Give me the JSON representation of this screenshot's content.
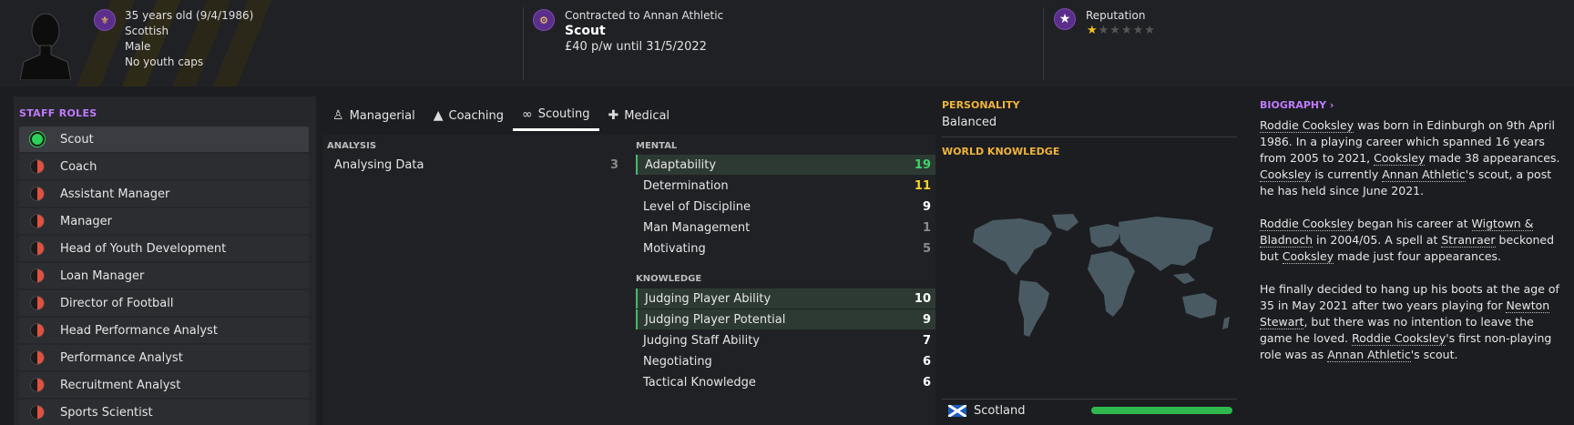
{
  "header": {
    "age_line": "35 years old (9/4/1986)",
    "nationality": "Scottish",
    "gender": "Male",
    "caps": "No youth caps",
    "contract_line": "Contracted to Annan Athletic",
    "job": "Scout",
    "wage_line": "£40 p/w until 31/5/2022",
    "reputation_label": "Reputation",
    "reputation_stars": 0.5,
    "reputation_max": 5
  },
  "staff_roles": {
    "title": "STAFF ROLES",
    "items": [
      {
        "label": "Scout",
        "status": "green"
      },
      {
        "label": "Coach",
        "status": "half"
      },
      {
        "label": "Assistant Manager",
        "status": "half"
      },
      {
        "label": "Manager",
        "status": "half"
      },
      {
        "label": "Head of Youth Development",
        "status": "half"
      },
      {
        "label": "Loan Manager",
        "status": "half"
      },
      {
        "label": "Director of Football",
        "status": "half"
      },
      {
        "label": "Head Performance Analyst",
        "status": "half"
      },
      {
        "label": "Performance Analyst",
        "status": "half"
      },
      {
        "label": "Recruitment Analyst",
        "status": "half"
      },
      {
        "label": "Sports Scientist",
        "status": "half"
      }
    ]
  },
  "tabs": [
    "Managerial",
    "Coaching",
    "Scouting",
    "Medical"
  ],
  "analysis": {
    "title": "ANALYSIS",
    "items": [
      {
        "label": "Analysing Data",
        "value": "3"
      }
    ]
  },
  "mental": {
    "title": "MENTAL",
    "items": [
      {
        "label": "Adaptability",
        "value": "19"
      },
      {
        "label": "Determination",
        "value": "11"
      },
      {
        "label": "Level of Discipline",
        "value": "9"
      },
      {
        "label": "Man Management",
        "value": "1"
      },
      {
        "label": "Motivating",
        "value": "5"
      }
    ]
  },
  "knowledge": {
    "title": "KNOWLEDGE",
    "items": [
      {
        "label": "Judging Player Ability",
        "value": "10"
      },
      {
        "label": "Judging Player Potential",
        "value": "9"
      },
      {
        "label": "Judging Staff Ability",
        "value": "7"
      },
      {
        "label": "Negotiating",
        "value": "6"
      },
      {
        "label": "Tactical Knowledge",
        "value": "6"
      }
    ]
  },
  "personality": {
    "title": "PERSONALITY",
    "value": "Balanced",
    "world_title": "WORLD KNOWLEDGE",
    "country": "Scotland",
    "country_knowledge": 1.0
  },
  "biography": {
    "title": "BIOGRAPHY ›",
    "p1": "was born in Edinburgh on 9th April 1986. In a playing career which spanned 16 years from 2005 to 2021,",
    "p1b": "made 38 appearances.",
    "p1c": "is currently",
    "p1d": "'s scout, a post he has held since June 2021.",
    "name": "Roddie Cooksley",
    "surname": "Cooksley",
    "club": "Annan Athletic",
    "p2a": "began his career at",
    "club2": "Wigtown & Bladnoch",
    "p2b": "in 2004/05. A spell at",
    "club3": "Stranraer",
    "p2c": "beckoned but",
    "p2d": "made just four appearances.",
    "p3a": "He finally decided to hang up his boots at the age of 35 in May 2021 after two years playing for",
    "club4": "Newton Stewart",
    "p3b": ", but there was no intention to leave the game he loved.",
    "p3c": "'s first non-playing role was as",
    "p3d": "'s scout."
  },
  "colors": {
    "accent_purple": "#c07aff",
    "accent_orange": "#f0b43c",
    "green": "#3fd46a",
    "yellow": "#f5d130"
  }
}
